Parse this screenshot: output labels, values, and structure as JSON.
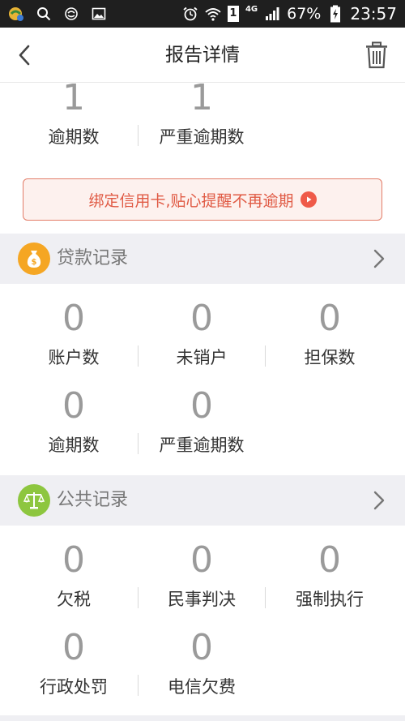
{
  "status_bar": {
    "icons_left": [
      "app-notification-icon",
      "search-icon",
      "sync-icon",
      "image-icon"
    ],
    "icons_right": [
      "alarm-icon",
      "wifi-icon",
      "sim-icon",
      "signal-icon",
      "battery-charging-icon"
    ],
    "sim_number": "1",
    "network": "4G",
    "battery": "67%",
    "time": "23:57"
  },
  "navbar": {
    "title": "报告详情"
  },
  "credit_card_summary": {
    "stats": [
      {
        "value": "1",
        "label": "逾期数"
      },
      {
        "value": "1",
        "label": "严重逾期数"
      }
    ]
  },
  "banner": {
    "text": "绑定信用卡,贴心提醒不再逾期"
  },
  "loan_records": {
    "title": "贷款记录",
    "stats": [
      {
        "value": "0",
        "label": "账户数"
      },
      {
        "value": "0",
        "label": "未销户"
      },
      {
        "value": "0",
        "label": "担保数"
      },
      {
        "value": "0",
        "label": "逾期数"
      },
      {
        "value": "0",
        "label": "严重逾期数"
      }
    ]
  },
  "public_records": {
    "title": "公共记录",
    "stats": [
      {
        "value": "0",
        "label": "欠税"
      },
      {
        "value": "0",
        "label": "民事判决"
      },
      {
        "value": "0",
        "label": "强制执行"
      },
      {
        "value": "0",
        "label": "行政处罚"
      },
      {
        "value": "0",
        "label": "电信欠费"
      }
    ]
  },
  "colors": {
    "status_bar_bg": "#1f1f1f",
    "section_bg": "#efeff3",
    "number_gray": "#9a9a9a",
    "banner_text": "#e05a44",
    "banner_border": "#e37d68",
    "loan_icon_bg": "#f5a623",
    "public_icon_bg": "#8dc63f"
  }
}
